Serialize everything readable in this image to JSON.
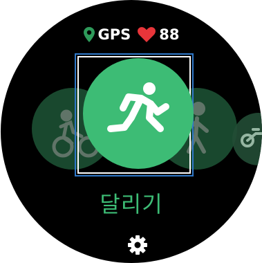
{
  "status": {
    "gps_label": "GPS",
    "heart_rate": "88",
    "gps_icon": "location-pin-icon",
    "heart_icon": "heart-icon"
  },
  "carousel": {
    "items": [
      {
        "icon": "cycling-icon",
        "selected": false
      },
      {
        "icon": "running-icon",
        "selected": true
      },
      {
        "icon": "walking-icon",
        "selected": false
      },
      {
        "icon": "indoor-cycling-icon",
        "selected": false
      }
    ]
  },
  "activity": {
    "label": "달리기"
  },
  "settings": {
    "icon": "gear-icon"
  },
  "colors": {
    "accent": "#3dbc75",
    "gps_pin": "#2e9a5a",
    "heart": "#e8353a",
    "background": "#000000",
    "selection_outer": "#2f78c8"
  }
}
